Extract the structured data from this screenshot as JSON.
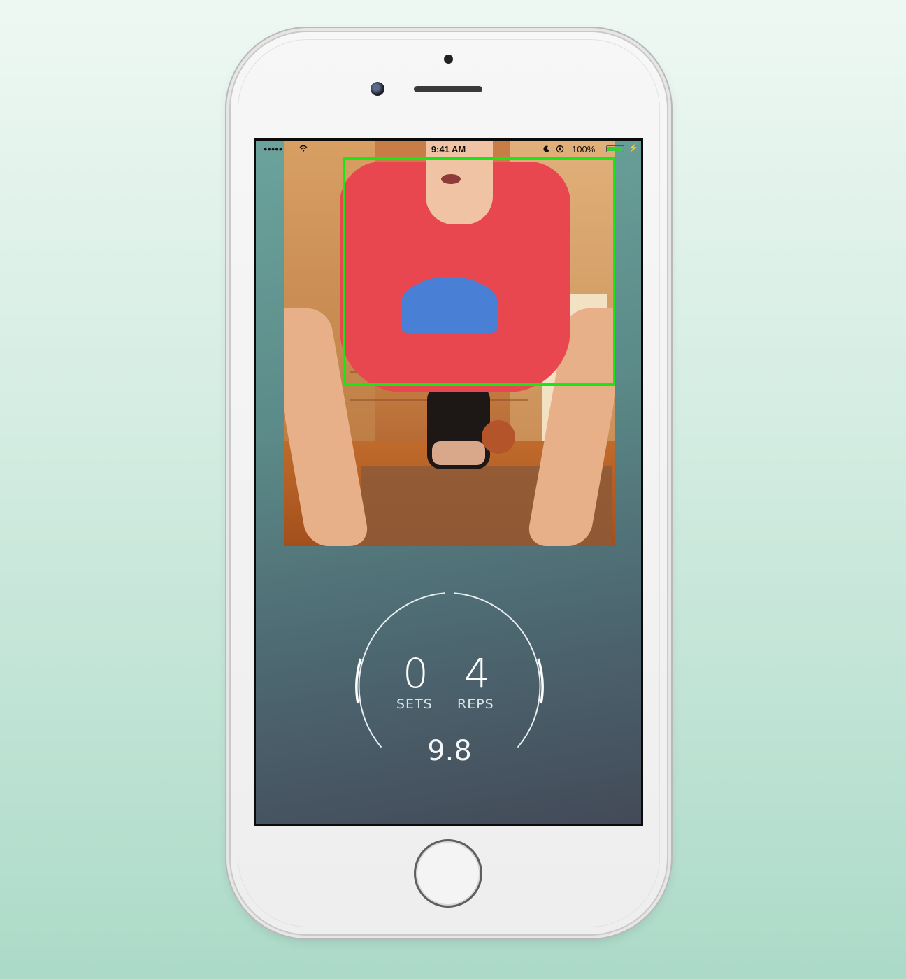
{
  "status_bar": {
    "signal_dots": "●●●●●",
    "time": "9:41 AM",
    "battery_percent": "100%",
    "battery_level": 1.0,
    "icons": [
      "wifi-icon",
      "moon-icon",
      "rotation-lock-icon",
      "battery-icon",
      "charging-icon"
    ]
  },
  "camera": {
    "detection_box_color": "#19e519"
  },
  "counter": {
    "sets_value": "0",
    "sets_label": "SETS",
    "reps_value": "4",
    "reps_label": "REPS",
    "timer": "9.8"
  },
  "colors": {
    "screen_gradient_top": "#6ba39c",
    "screen_gradient_bottom": "#434a58",
    "page_background": "#acdac8"
  }
}
